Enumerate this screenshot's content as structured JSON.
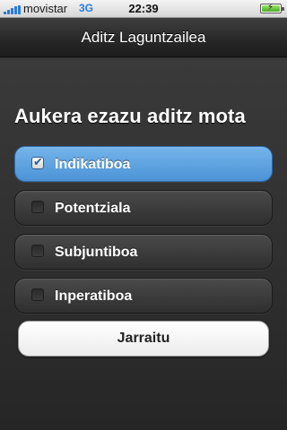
{
  "status_bar": {
    "carrier": "movistar",
    "network": "3G",
    "time": "22:39",
    "signal_icon": "signal-bars-icon",
    "battery_icon": "battery-charging-icon"
  },
  "nav": {
    "title": "Aditz Laguntzailea"
  },
  "main": {
    "heading": "Aukera ezazu aditz mota",
    "options": [
      {
        "label": "Indikatiboa",
        "checked": true
      },
      {
        "label": "Potentziala",
        "checked": false
      },
      {
        "label": "Subjuntiboa",
        "checked": false
      },
      {
        "label": "Inperatiboa",
        "checked": false
      }
    ],
    "continue_label": "Jarraitu"
  },
  "colors": {
    "selected_option": "#5fa3e0",
    "option_background": "#3c3c3c",
    "accent": "#2c7bd8"
  }
}
